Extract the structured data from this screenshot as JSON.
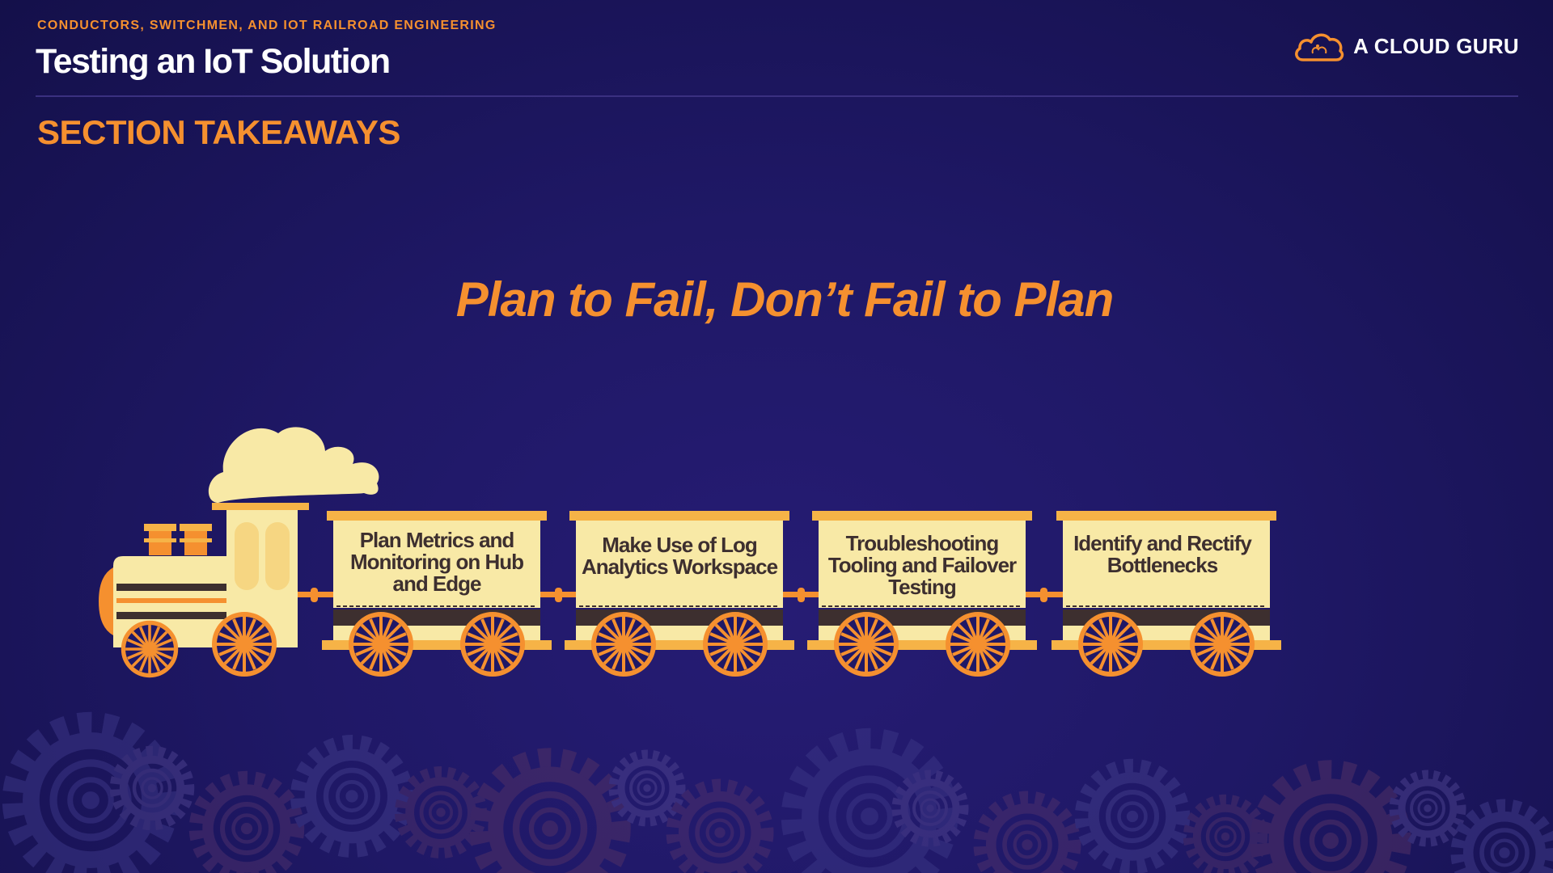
{
  "header": {
    "kicker": "CONDUCTORS, SWITCHMEN, AND IOT RAILROAD ENGINEERING",
    "course_title": "Testing an IoT Solution",
    "brand_name": "A CLOUD GURU"
  },
  "section_title": "SECTION TAKEAWAYS",
  "headline": "Plan to Fail, Don’t Fail to Plan",
  "train": {
    "cars": [
      {
        "label": "Plan Metrics and Monitoring on Hub and Edge"
      },
      {
        "label": "Make Use of Log Analytics Workspace"
      },
      {
        "label": "Troubleshooting Tooling and Failover Testing"
      },
      {
        "label": "Identify and Rectify Bottlenecks"
      }
    ]
  },
  "icons": {
    "brand": "cloud-logo-icon",
    "engine": "locomotive-icon",
    "background": "gear-icon"
  },
  "colors": {
    "background": "#1e1660",
    "accent": "#f5902f",
    "car_body": "#f8e9a6",
    "car_trim": "#f6b347",
    "text_dark": "#3d2f2f"
  }
}
